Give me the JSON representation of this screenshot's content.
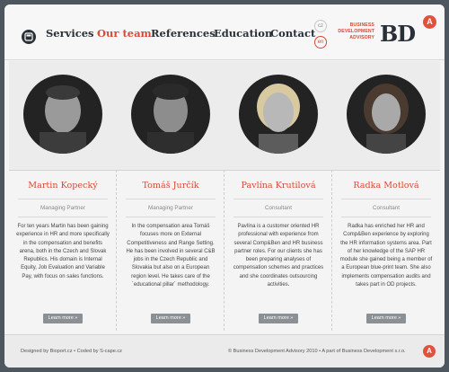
{
  "header": {
    "nav": [
      {
        "label": "Services",
        "active": false
      },
      {
        "label": "Our team",
        "active": true
      },
      {
        "label": "References",
        "active": false
      },
      {
        "label": "Education",
        "active": false
      },
      {
        "label": "Contact",
        "active": false
      }
    ],
    "languages": [
      "cz",
      "en"
    ],
    "brand": {
      "subtitle_1": "BUSINESS",
      "subtitle_2": "DEVELOPMENT",
      "subtitle_3": "ADVISORY",
      "logo": "BD",
      "badge": "A"
    },
    "home_icon": "home-icon"
  },
  "team": [
    {
      "name": "Martin Kopecký",
      "role": "Managing Partner",
      "bio": "For ten years Martin has been gaining experience in HR and more specifically in the compensation and benefits arena, both in the Czech and Slovak Republics. His domain is Internal Equity, Job Evaluation and Variable Pay, with focus on sales functions.",
      "button": "Learn more »"
    },
    {
      "name": "Tomáš Jurčík",
      "role": "Managing Partner",
      "bio": "In the compensation area Tomáš focuses more on External Competitiveness and Range Setting. He has been involved in several C&B jobs in the Czech Republic and Slovakia but also on a European region level. He takes care of the ´educational pillar´ methodology.",
      "button": "Learn more »"
    },
    {
      "name": "Pavlína Krutilová",
      "role": "Consultant",
      "bio": "Pavlína is a customer oriented HR professional with experience from several Comp&Ben and HR business partner roles. For our clients she has been preparing analyses of compensation schemes and practices and she coordinates outsourcing activities.",
      "button": "Learn more »"
    },
    {
      "name": "Radka Motlová",
      "role": "Consultant",
      "bio": "Radka has enriched her HR and Comp&Ben experience by exploring the HR information systems area. Part of her knowledge of the SAP HR module she gained being a member of a European blue-print team. She also implements compensation audits and takes part in OD projects.",
      "button": "Learn more »"
    }
  ],
  "footer": {
    "left": "Designed by Bioport.cz • Coded by S-cape.cz",
    "right": "© Business Development Advisory 2010 • A part of Business Development s.r.o.",
    "badge": "A"
  }
}
